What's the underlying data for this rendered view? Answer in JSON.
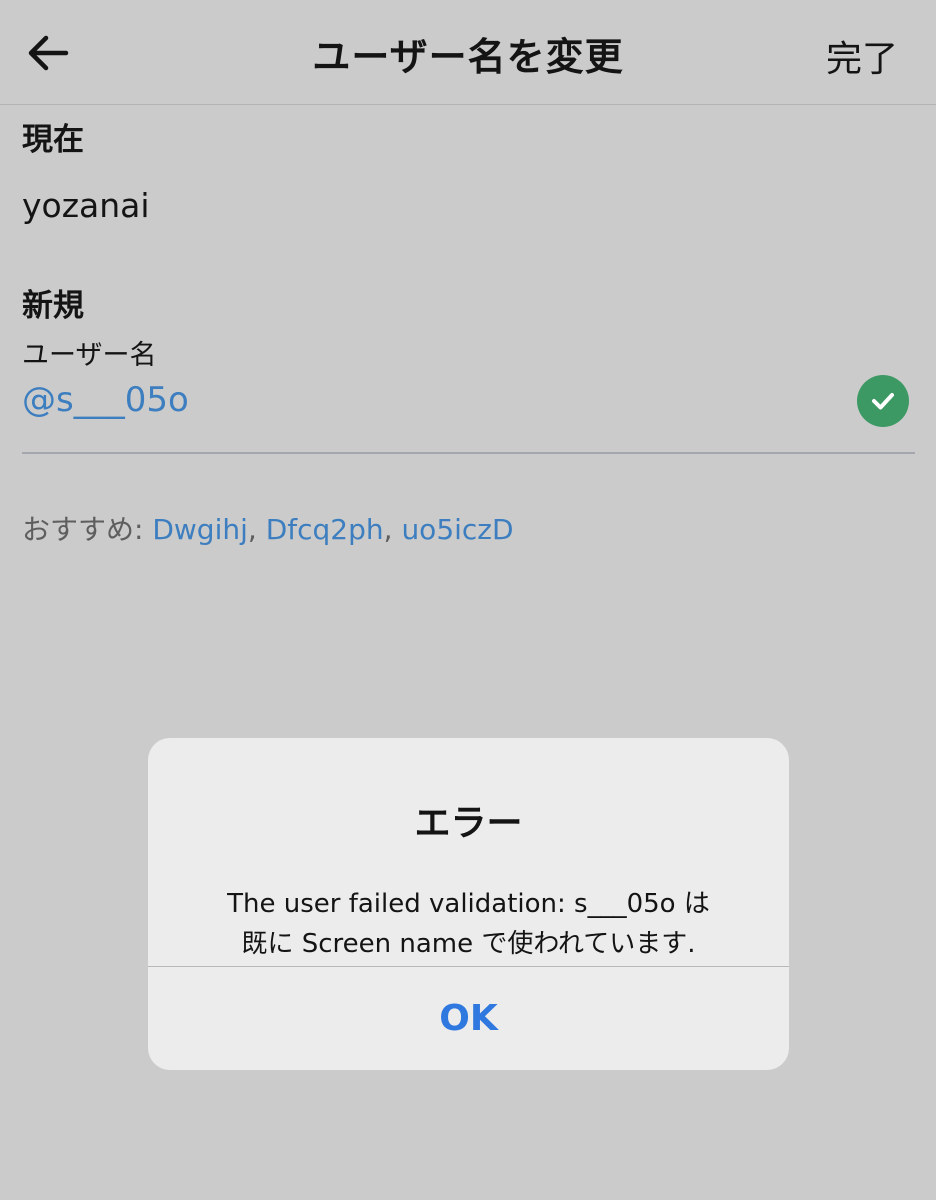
{
  "header": {
    "back_icon": "arrow-left-icon",
    "title": "ユーザー名を変更",
    "done_label": "完了"
  },
  "current": {
    "label": "現在",
    "value": "yozanai"
  },
  "new": {
    "label": "新規",
    "field_label": "ユーザー名",
    "field_value": "@s___05o",
    "status_icon": "check-circle-icon",
    "status_color": "#3c9963"
  },
  "suggestions": {
    "prefix": "おすすめ: ",
    "items": [
      "Dwgihj",
      "Dfcq2ph",
      "uo5iczD"
    ],
    "separator": ", "
  },
  "dialog": {
    "title": "エラー",
    "message_line1": "The user failed validation: s___05o は",
    "message_line2": "既に Screen name で使われています.",
    "ok_label": "OK",
    "ok_color": "#2f78e0"
  },
  "colors": {
    "background": "#cbcbcb",
    "link": "#3c7ebf"
  }
}
